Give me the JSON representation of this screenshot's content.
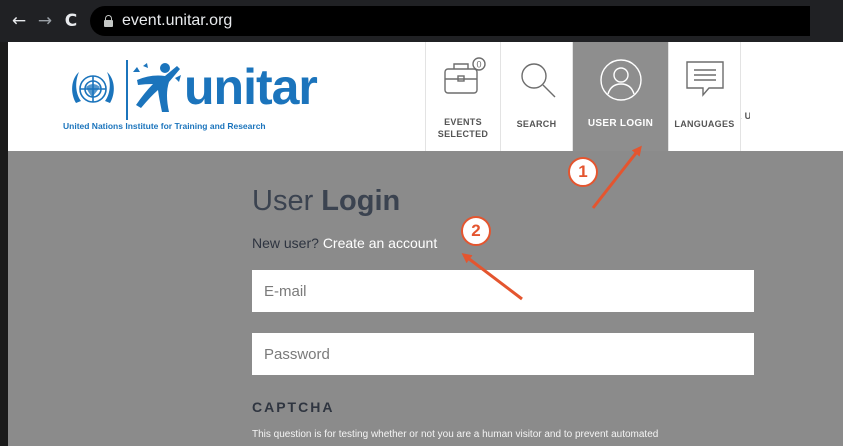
{
  "browser": {
    "back_icon": "←",
    "forward_icon": "→",
    "reload_icon": "C",
    "url": "event.unitar.org"
  },
  "header": {
    "logo_wordmark": "unitar",
    "logo_tagline": "United Nations Institute for Training and Research",
    "nav": [
      {
        "label_line1": "EVENTS",
        "label_line2": "SELECTED",
        "badge_count": "0"
      },
      {
        "label": "SEARCH"
      },
      {
        "label": "USER LOGIN"
      },
      {
        "label": "LANGUAGES"
      },
      {
        "label": "E U"
      }
    ]
  },
  "login": {
    "title_light": "User ",
    "title_bold": "Login",
    "new_user_text": "New user? ",
    "create_account_link": "Create an account",
    "email_placeholder": "E-mail",
    "password_placeholder": "Password",
    "captcha_heading": "CAPTCHA",
    "captcha_description": "This question is for testing whether or not you are a human visitor and to prevent automated"
  },
  "annotations": {
    "step1": "1",
    "step2": "2"
  },
  "colors": {
    "brand_blue": "#1b74bc",
    "active_nav": "#8e8e8e",
    "main_bg": "#8b8b8b",
    "annotation": "#e4552f"
  }
}
